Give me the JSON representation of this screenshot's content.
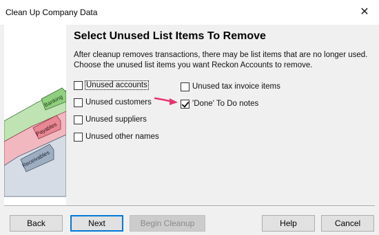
{
  "window": {
    "title": "Clean Up Company Data"
  },
  "page": {
    "heading": "Select Unused List Items To Remove",
    "description": "After cleanup removes transactions, there may be list items that are no longer used. Choose the unused list items you want Reckon Accounts to remove."
  },
  "illustration": {
    "tab1": "Banking",
    "tab2": "Payables",
    "tab3": "Receivables"
  },
  "options": {
    "unused_accounts": {
      "label": "Unused accounts",
      "checked": false
    },
    "unused_customers": {
      "label": "Unused customers",
      "checked": false
    },
    "unused_suppliers": {
      "label": "Unused suppliers",
      "checked": false
    },
    "unused_other_names": {
      "label": "Unused other names",
      "checked": false
    },
    "unused_tax_invoice_items": {
      "label": "Unused tax invoice items",
      "checked": false
    },
    "done_todo_notes": {
      "label": "'Done' To Do notes",
      "checked": true
    }
  },
  "buttons": {
    "back": "Back",
    "next": "Next",
    "begin_cleanup": "Begin Cleanup",
    "help": "Help",
    "cancel": "Cancel"
  },
  "colors": {
    "accent": "#0078d7",
    "arrow": "#e8336e"
  }
}
